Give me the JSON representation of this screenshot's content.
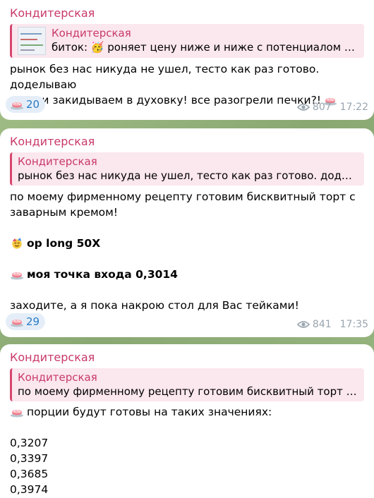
{
  "messages": [
    {
      "sender": "Кондитерская",
      "reply": {
        "name": "Кондитерская",
        "text": "биток: 🥳 роняет цену ниже и ниже с потенциалом па..."
      },
      "lines": [
        "рынок без нас никуда не ушел, тесто как раз готово. доделываю",
        "крем и закидываем в духовку! все разогрели печки?!"
      ],
      "reaction_count": "20",
      "views": "807",
      "time": "17:22"
    },
    {
      "sender": "Кондитерская",
      "reply": {
        "name": "Кондитерская",
        "text": "рынок без нас никуда не ушел, тесто как раз готово. доделы..."
      },
      "lines": [
        "по моему фирменному рецепту готовим бисквитный торт с",
        "заварным кремом!",
        "op long 50X",
        "моя точка входа 0,3014",
        "заходите, а я пока накрою стол для Вас тейками!"
      ],
      "reaction_count": "29",
      "views": "841",
      "time": "17:35"
    },
    {
      "sender": "Кондитерская",
      "reply": {
        "name": "Кондитерская",
        "text": "по моему фирменному рецепту готовим бисквитный торт с ..."
      },
      "lines": [
        "порции будут готовы на таких значениях:",
        "0,3207",
        "0,3397",
        "0,3685",
        "0,3974"
      ]
    }
  ],
  "icons": {
    "reaction": "cake-icon",
    "views": "eye-icon",
    "party": "party-face-icon"
  }
}
